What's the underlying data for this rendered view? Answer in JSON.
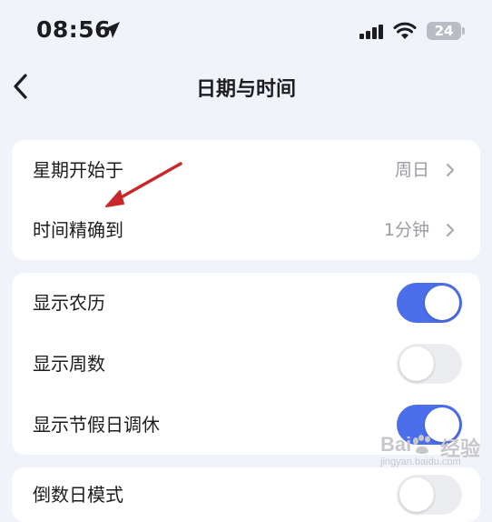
{
  "status_bar": {
    "time": "08:56",
    "battery": "24"
  },
  "nav": {
    "title": "日期与时间"
  },
  "sections": [
    {
      "rows": [
        {
          "label": "星期开始于",
          "value": "周日"
        },
        {
          "label": "时间精确到",
          "value": "1分钟"
        }
      ]
    },
    {
      "rows": [
        {
          "label": "显示农历",
          "toggle": "on"
        },
        {
          "label": "显示周数",
          "toggle": "off"
        },
        {
          "label": "显示节假日调休",
          "toggle": "on"
        }
      ]
    },
    {
      "rows": [
        {
          "label": "倒数日模式",
          "toggle": "off"
        }
      ]
    }
  ],
  "colors": {
    "accent": "#4b6eea",
    "annotation_arrow": "#c8282a",
    "background": "#f1f3fb"
  },
  "watermark": {
    "brand": "Bai",
    "brand_cn": "经验",
    "url": "jingyan.baidu.com"
  }
}
